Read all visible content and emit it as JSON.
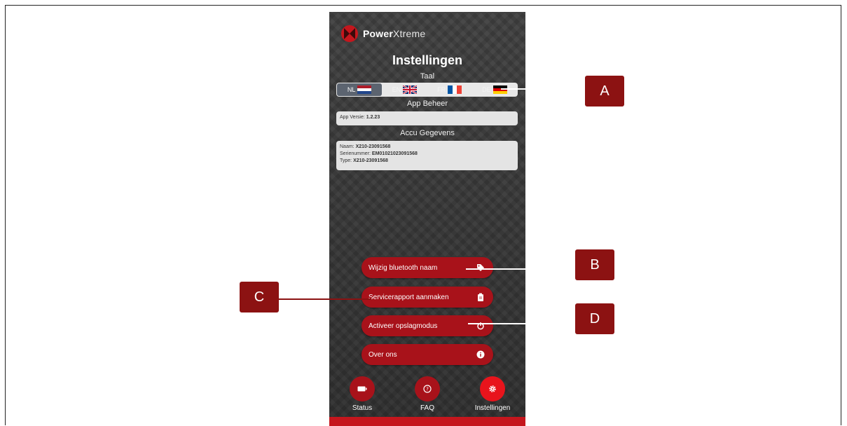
{
  "brand": {
    "bold": "Power",
    "light": "Xtreme"
  },
  "title": "Instellingen",
  "language": {
    "label": "Taal",
    "options": [
      {
        "code": "NL",
        "active": true
      },
      {
        "code": "EN",
        "active": false
      },
      {
        "code": "FR",
        "active": false
      },
      {
        "code": "DE",
        "active": false
      }
    ]
  },
  "app_management": {
    "label": "App Beheer",
    "version_label": "App Versie: ",
    "version_value": "1.2.23"
  },
  "battery": {
    "label": "Accu Gegevens",
    "name_label": "Naam: ",
    "name_value": "X210-23091568",
    "serial_label": "Serienummer: ",
    "serial_value": "EM0102102309156­8",
    "type_label": "Type: ",
    "type_value": "X210-23091568"
  },
  "actions": [
    {
      "label": "Wijzig bluetooth naam",
      "icon": "tag-icon"
    },
    {
      "label": "Servicerapport aanmaken",
      "icon": "clipboard-icon"
    },
    {
      "label": "Activeer opslagmodus",
      "icon": "power-icon"
    },
    {
      "label": "Over ons",
      "icon": "info-icon"
    }
  ],
  "nav": [
    {
      "label": "Status",
      "icon": "battery-icon",
      "active": false
    },
    {
      "label": "FAQ",
      "icon": "help-icon",
      "active": false
    },
    {
      "label": "Instellingen",
      "icon": "gear-icon",
      "active": true
    }
  ],
  "callouts": {
    "a": "A",
    "b": "B",
    "c": "C",
    "d": "D"
  },
  "colors": {
    "accent": "#a8121a",
    "active_nav": "#e8141c",
    "callout": "#8c1212"
  }
}
